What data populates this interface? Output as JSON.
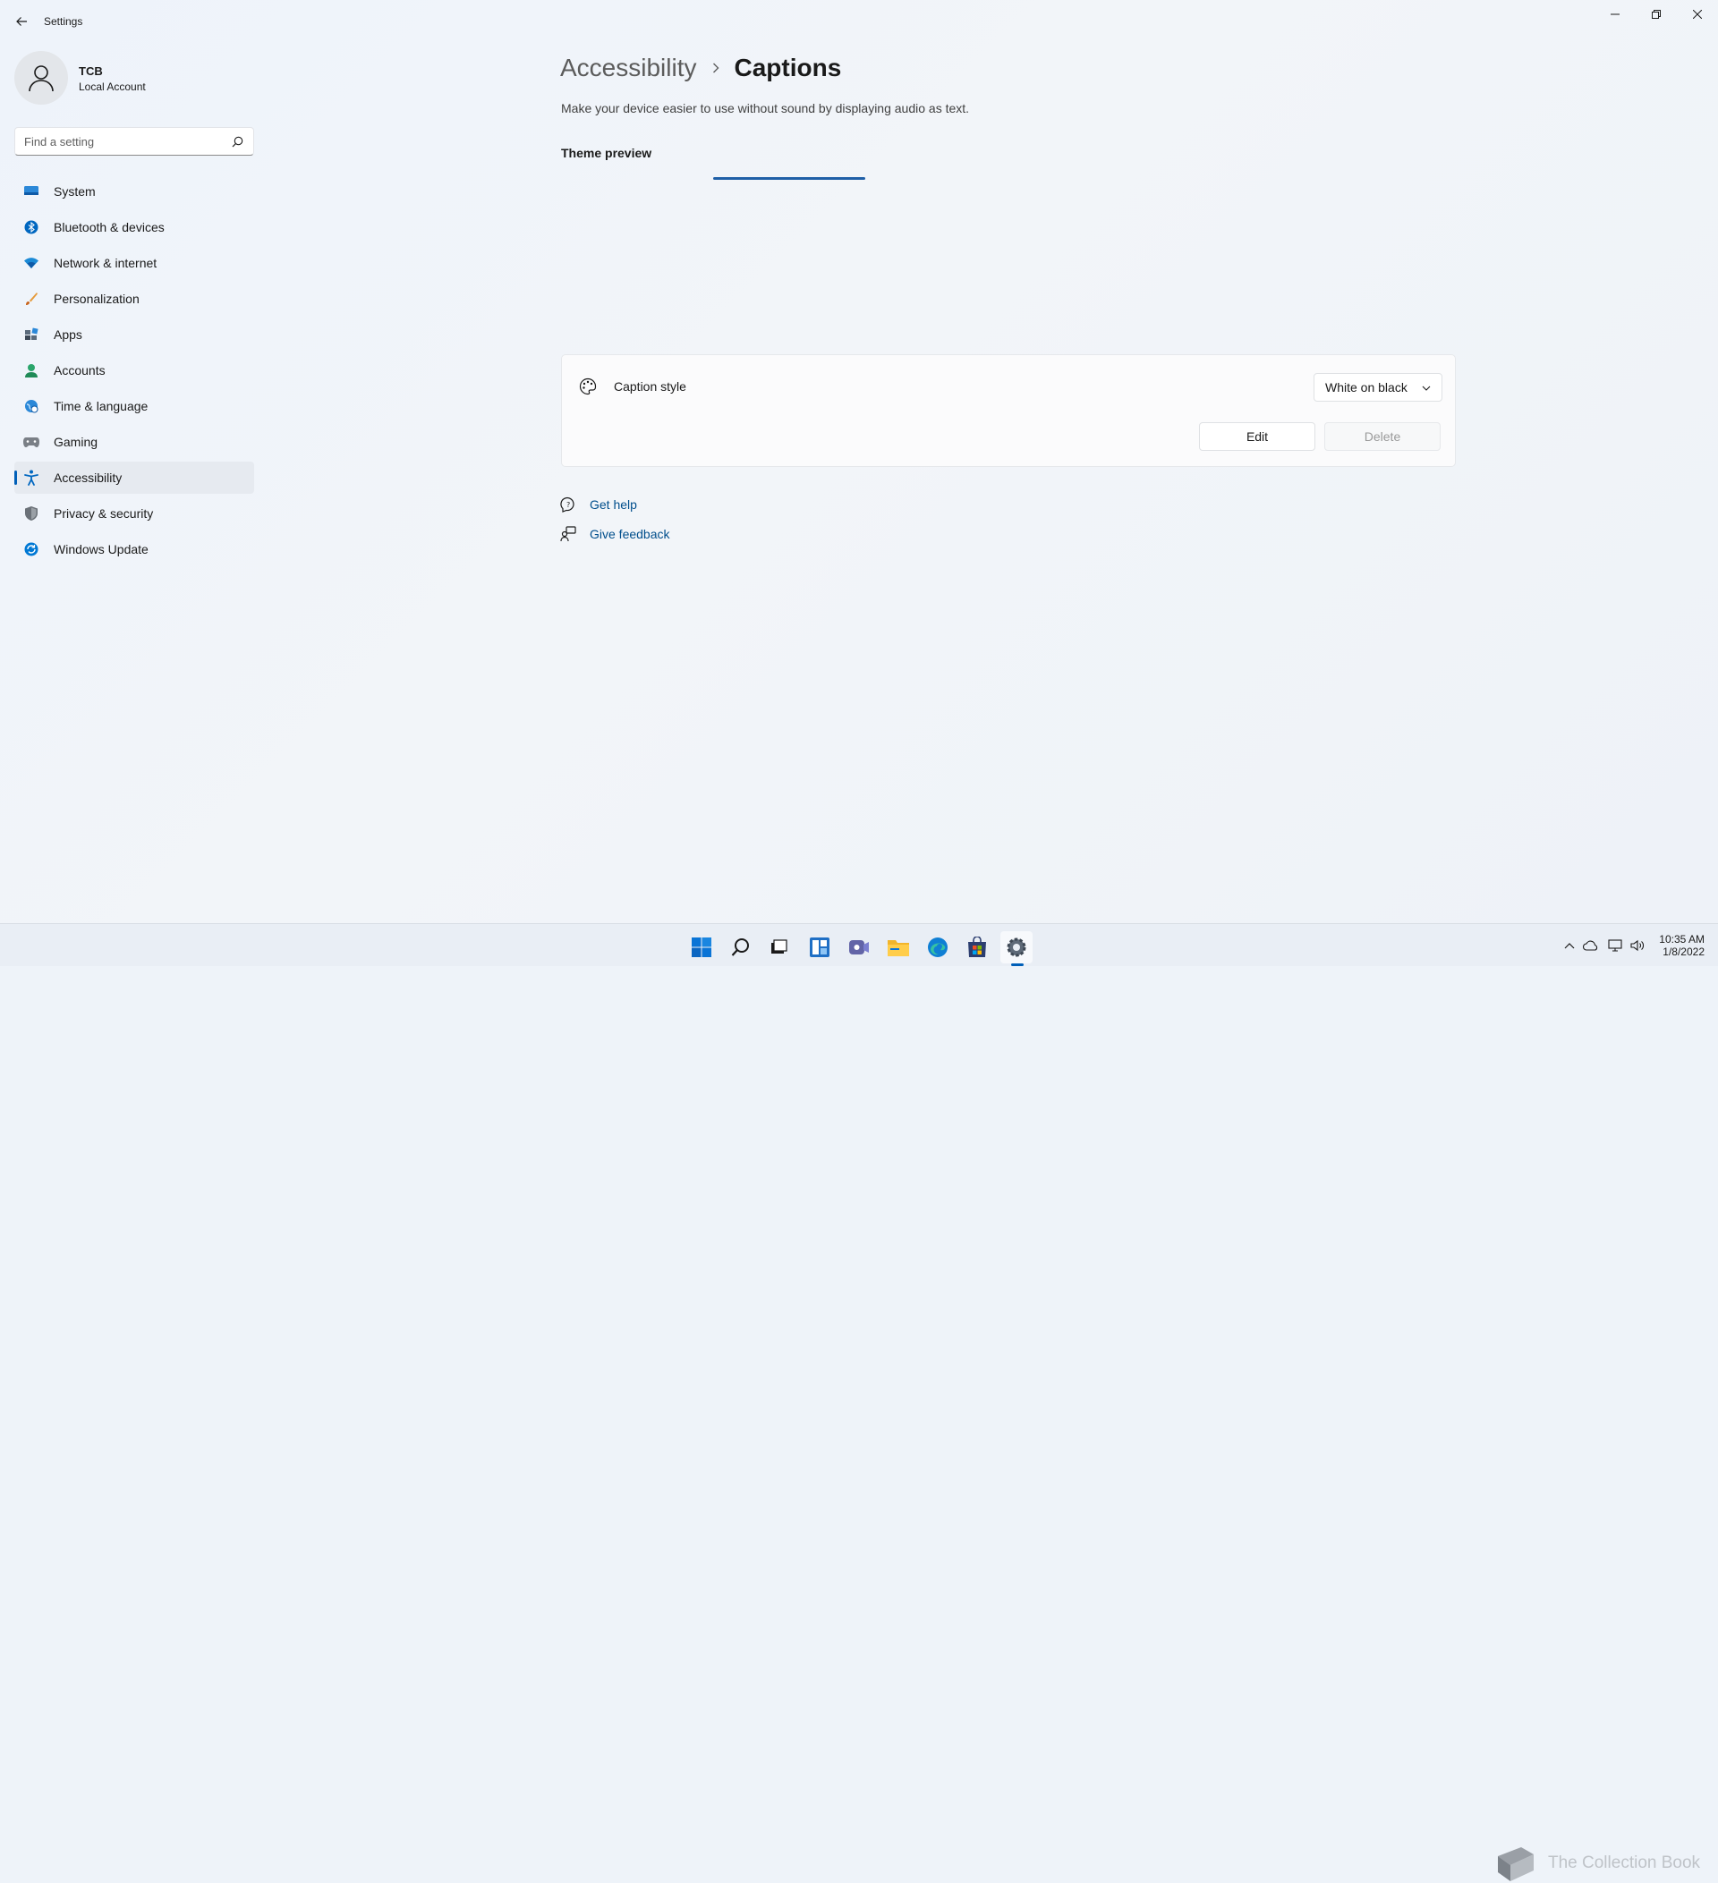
{
  "window": {
    "title": "Settings"
  },
  "profile": {
    "name": "TCB",
    "account_type": "Local Account"
  },
  "search": {
    "placeholder": "Find a setting"
  },
  "sidebar": {
    "items": [
      {
        "label": "System",
        "icon": "system-icon",
        "color": "#0078d4"
      },
      {
        "label": "Bluetooth & devices",
        "icon": "bluetooth-icon",
        "color": "#0067c0"
      },
      {
        "label": "Network & internet",
        "icon": "wifi-icon",
        "color": "#1b8ad6"
      },
      {
        "label": "Personalization",
        "icon": "brush-icon",
        "color": "#d87b2b"
      },
      {
        "label": "Apps",
        "icon": "apps-icon",
        "color": "#5b6b7c"
      },
      {
        "label": "Accounts",
        "icon": "accounts-icon",
        "color": "#26a269"
      },
      {
        "label": "Time & language",
        "icon": "globe-clock-icon",
        "color": "#1b8ad6"
      },
      {
        "label": "Gaming",
        "icon": "gamepad-icon",
        "color": "#7a7f86"
      },
      {
        "label": "Accessibility",
        "icon": "accessibility-icon",
        "color": "#0067c0",
        "active": true
      },
      {
        "label": "Privacy & security",
        "icon": "shield-icon",
        "color": "#6b7178"
      },
      {
        "label": "Windows Update",
        "icon": "update-icon",
        "color": "#0078d4"
      }
    ]
  },
  "main": {
    "breadcrumb_parent": "Accessibility",
    "breadcrumb_current": "Captions",
    "description": "Make your device easier to use without sound by displaying audio as text.",
    "preview_title": "Theme preview",
    "caption_style": {
      "label": "Caption style",
      "value": "White on black",
      "edit_label": "Edit",
      "delete_label": "Delete"
    },
    "links": {
      "help": "Get help",
      "feedback": "Give feedback"
    }
  },
  "taskbar": {
    "time": "10:35 AM",
    "date": "1/8/2022",
    "watermark": "The Collection Book",
    "apps": [
      "start-icon",
      "search-icon",
      "task-view-icon",
      "widgets-icon",
      "chat-icon",
      "file-explorer-icon",
      "edge-icon",
      "store-icon",
      "settings-icon"
    ]
  },
  "colors": {
    "accent": "#005fb8",
    "link": "#004e8c"
  }
}
